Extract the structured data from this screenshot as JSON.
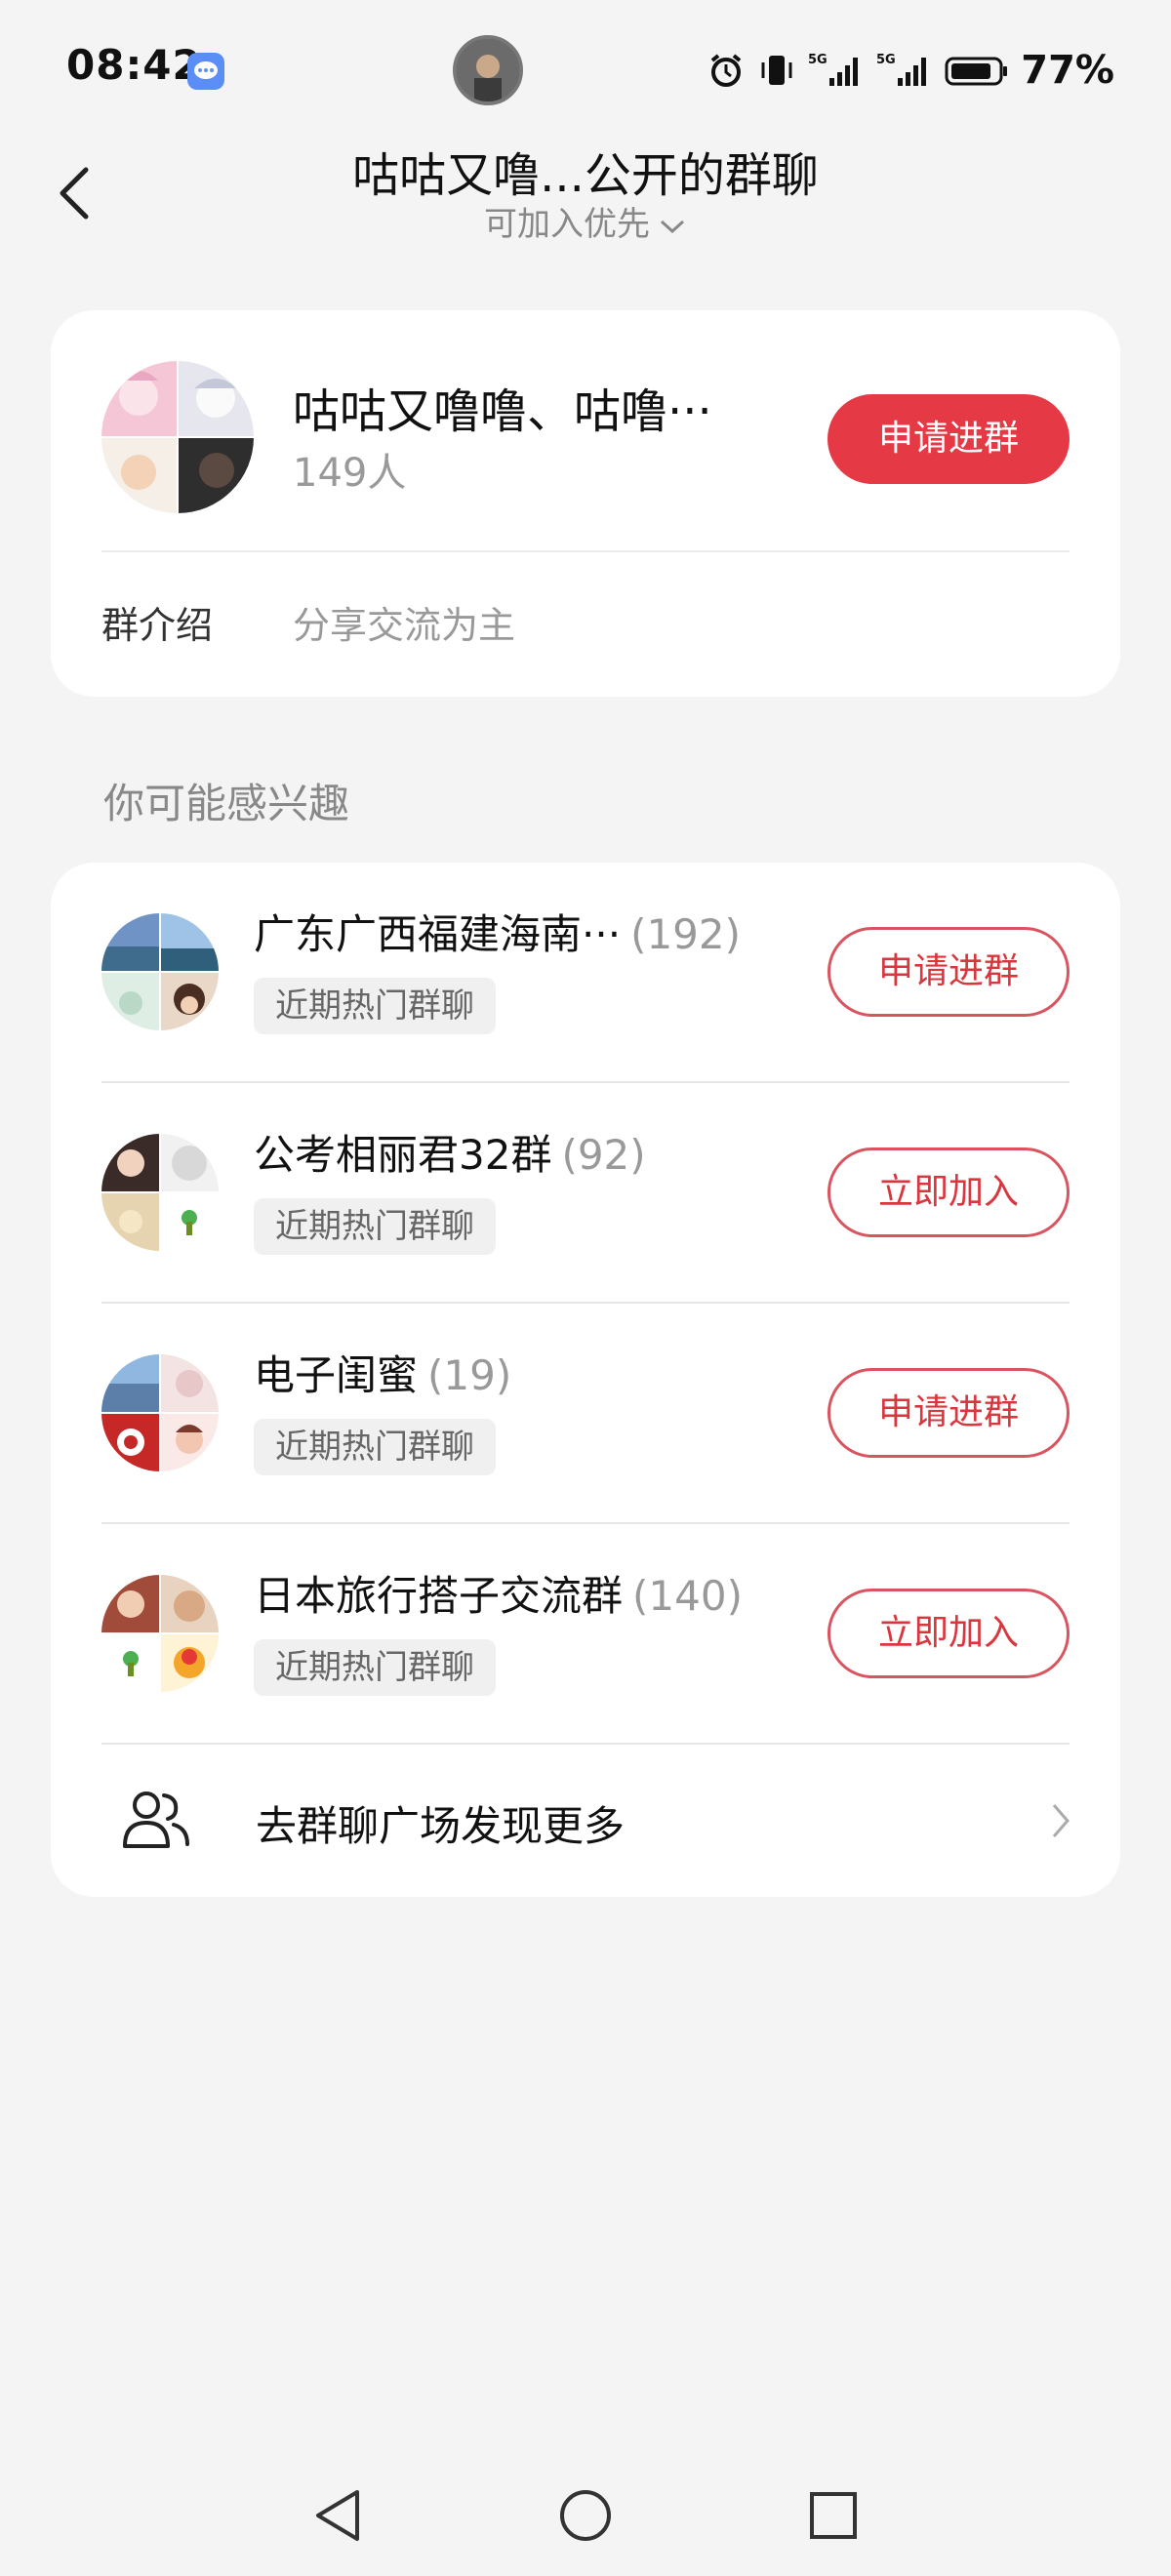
{
  "status_bar": {
    "time": "08:42",
    "battery": "77%",
    "icons": [
      "message-app-icon",
      "alarm-icon",
      "vibrate-icon",
      "5g-signal-icon",
      "5g-signal-icon",
      "battery-icon"
    ]
  },
  "header": {
    "title": "咕咕又噜...公开的群聊",
    "subtitle": "可加入优先"
  },
  "group": {
    "name": "咕咕又噜噜、咕噜···",
    "count": "149人",
    "join_label": "申请进群",
    "intro_label": "群介绍",
    "intro_value": "分享交流为主"
  },
  "section_title": "你可能感兴趣",
  "recommendations": [
    {
      "name": "广东广西福建海南···",
      "count": "(192)",
      "tag": "近期热门群聊",
      "action": "申请进群"
    },
    {
      "name": "公考相丽君32群",
      "count": "(92)",
      "tag": "近期热门群聊",
      "action": "立即加入"
    },
    {
      "name": "电子闺蜜",
      "count": "(19)",
      "tag": "近期热门群聊",
      "action": "申请进群"
    },
    {
      "name": "日本旅行搭子交流群",
      "count": "(140)",
      "tag": "近期热门群聊",
      "action": "立即加入"
    }
  ],
  "more": {
    "label": "去群聊广场发现更多"
  },
  "colors": {
    "accent": "#e63946",
    "background": "#f4f4f4",
    "card": "#ffffff"
  }
}
